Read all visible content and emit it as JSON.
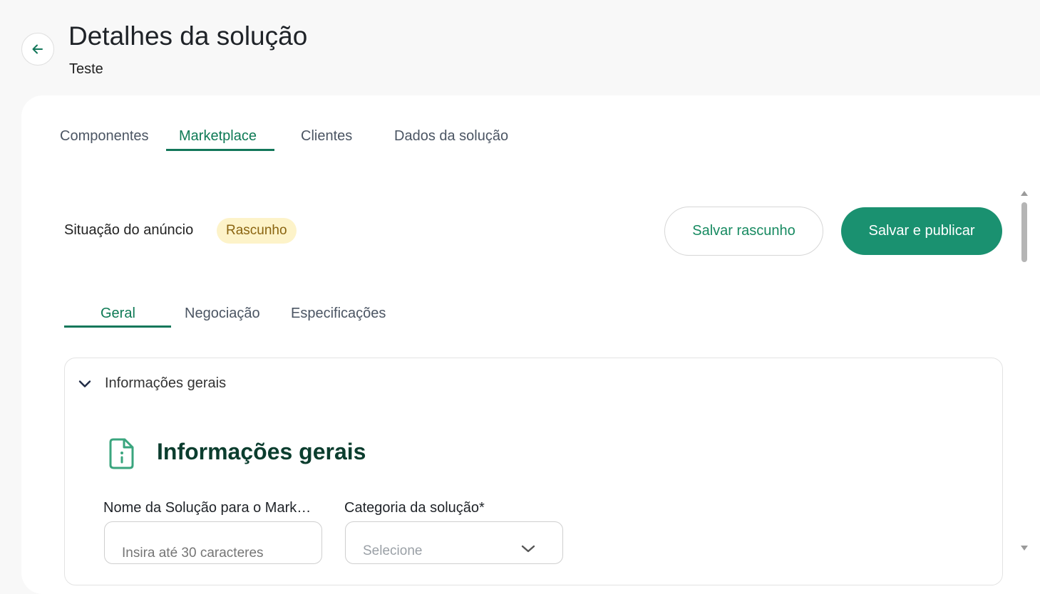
{
  "header": {
    "title": "Detalhes da solução",
    "subtitle": "Teste"
  },
  "tabs": [
    {
      "label": "Componentes",
      "active": false
    },
    {
      "label": "Marketplace",
      "active": true
    },
    {
      "label": "Clientes",
      "active": false
    },
    {
      "label": "Dados da solução",
      "active": false
    }
  ],
  "status": {
    "label": "Situação do anúncio",
    "badge": "Rascunho"
  },
  "actions": {
    "save_draft": "Salvar rascunho",
    "save_publish": "Salvar e publicar"
  },
  "subtabs": [
    {
      "label": "Geral",
      "active": true
    },
    {
      "label": "Negociação",
      "active": false
    },
    {
      "label": "Especificações",
      "active": false
    }
  ],
  "accordion": {
    "title": "Informações gerais",
    "section_title": "Informações gerais"
  },
  "fields": {
    "name_label": "Nome da Solução para o Marketplace*",
    "name_placeholder": "Insira até 30 caracteres",
    "category_label": "Categoria da solução*",
    "category_placeholder": "Selecione"
  },
  "colors": {
    "accent": "#13775a",
    "primary_button": "#1a9170",
    "badge_bg": "#fdf3c9",
    "badge_text": "#8a6410",
    "section_title": "#0b3d2e"
  },
  "icons": {
    "back": "arrow-left-icon",
    "accordion": "chevron-down-icon",
    "section": "file-info-icon",
    "select": "chevron-down-icon"
  }
}
